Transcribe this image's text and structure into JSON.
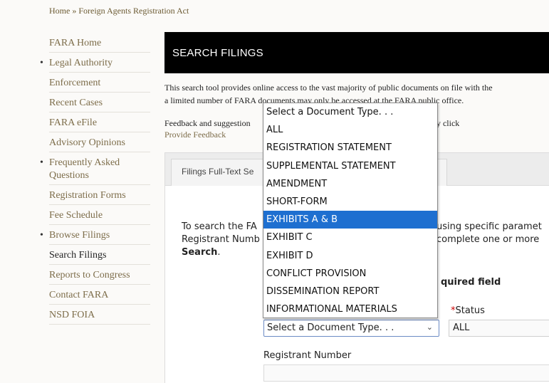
{
  "breadcrumb": {
    "home": "Home",
    "sep": "»",
    "current": "Foreign Agents Registration Act"
  },
  "sidebar": {
    "items": [
      {
        "label": "FARA Home",
        "bullet": false
      },
      {
        "label": "Legal Authority",
        "bullet": true
      },
      {
        "label": "Enforcement",
        "bullet": false
      },
      {
        "label": "Recent Cases",
        "bullet": false
      },
      {
        "label": "FARA eFile",
        "bullet": false
      },
      {
        "label": "Advisory Opinions",
        "bullet": false
      },
      {
        "label": "Frequently Asked Questions",
        "bullet": true
      },
      {
        "label": "Registration Forms",
        "bullet": false
      },
      {
        "label": "Fee Schedule",
        "bullet": false
      },
      {
        "label": "Browse Filings",
        "bullet": true
      },
      {
        "label": "Search Filings",
        "bullet": false,
        "active": true
      },
      {
        "label": "Reports to Congress",
        "bullet": false
      },
      {
        "label": "Contact FARA",
        "bullet": false
      },
      {
        "label": "NSD FOIA",
        "bullet": false
      }
    ]
  },
  "header": {
    "title": "SEARCH FILINGS"
  },
  "intro": {
    "line1": "This search tool provides online access to the vast majority of public documents on file with the",
    "line2": "a limited number of FARA documents may only be accessed at the FARA public office.",
    "feedback_prefix": "Feedback and suggestion",
    "feedback_suffix": "nd can be submitted by click",
    "feedback_link": "Provide Feedback"
  },
  "panel": {
    "tab_label": "Filings Full-Text Se",
    "text_line1": "To search the FA",
    "text_line1_right": "using specific paramet",
    "text_line2": "Registrant Numb",
    "text_line2_right": "complete one or more",
    "text_line3": "Search",
    "text_line3_end": ".",
    "required_note": "quired field",
    "status_label": "Status",
    "status_star": "*",
    "status_value": "ALL",
    "doc_type_value": "Select a Document Type. . .",
    "registrant_label": "Registrant Number"
  },
  "dropdown": {
    "options": [
      "Select a Document Type. . .",
      "ALL",
      "REGISTRATION STATEMENT",
      "SUPPLEMENTAL STATEMENT",
      "AMENDMENT",
      "SHORT-FORM",
      "EXHIBITS A & B",
      "EXHIBIT C",
      "EXHIBIT D",
      "CONFLICT PROVISION",
      "DISSEMINATION REPORT",
      "INFORMATIONAL MATERIALS"
    ],
    "selected": "EXHIBITS A & B"
  },
  "colors": {
    "header_bg": "#000000",
    "link": "#7d6d4a",
    "highlight": "#1e6fd0",
    "required_star": "#cc0000"
  },
  "icons": {
    "select_chevron": "chevron-down-icon"
  }
}
